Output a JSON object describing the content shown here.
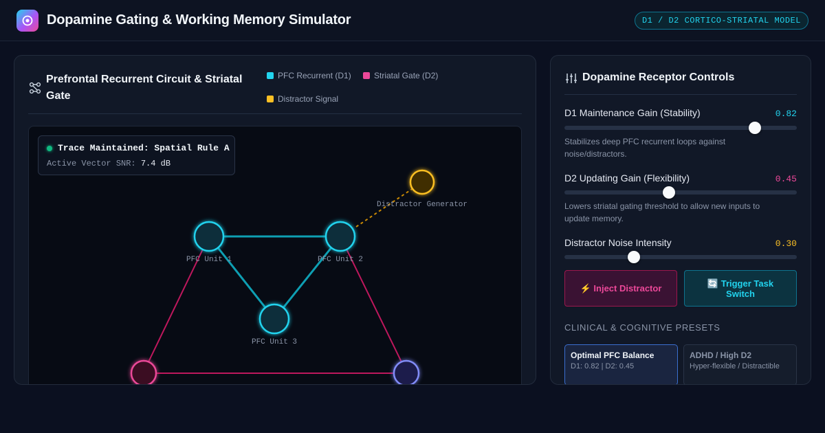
{
  "app": {
    "title": "Dopamine Gating & Working Memory Simulator",
    "model_badge": "D1 / D2 CORTICO-STRIATAL MODEL"
  },
  "circuit_panel": {
    "title": "Prefrontal Recurrent Circuit & Striatal Gate",
    "legend": [
      {
        "label": "PFC Recurrent (D1)",
        "color": "#22d3ee"
      },
      {
        "label": "Striatal Gate (D2)",
        "color": "#ec4899"
      },
      {
        "label": "Distractor Signal",
        "color": "#fbbf24"
      }
    ],
    "status": {
      "text": "Trace Maintained: Spatial Rule A",
      "snr_label": "Active Vector SNR:",
      "snr_value": "7.4 dB"
    },
    "nodes": {
      "pfc1": "PFC Unit 1",
      "pfc2": "PFC Unit 2",
      "pfc3": "PFC Unit 3",
      "distractor": "Distractor Generator"
    }
  },
  "controls_panel": {
    "title": "Dopamine Receptor Controls",
    "sliders": [
      {
        "label": "D1 Maintenance Gain (Stability)",
        "value_text": "0.82",
        "value": 0.82,
        "color": "#22d3ee",
        "description": "Stabilizes deep PFC recurrent loops against noise/distractors."
      },
      {
        "label": "D2 Updating Gain (Flexibility)",
        "value_text": "0.45",
        "value": 0.45,
        "color": "#ec4899",
        "description": "Lowers striatal gating threshold to allow new inputs to update memory."
      },
      {
        "label": "Distractor Noise Intensity",
        "value_text": "0.30",
        "value": 0.3,
        "color": "#fbbf24",
        "description": ""
      }
    ],
    "buttons": {
      "inject": "⚡ Inject Distractor",
      "switch": "🔄 Trigger Task Switch"
    },
    "presets_heading": "CLINICAL & COGNITIVE PRESETS",
    "presets": [
      {
        "name": "Optimal PFC Balance",
        "sub": "D1: 0.82 | D2: 0.45",
        "active": true
      },
      {
        "name": "ADHD / High D2",
        "sub": "Hyper-flexible / Distractible",
        "active": false
      }
    ]
  }
}
